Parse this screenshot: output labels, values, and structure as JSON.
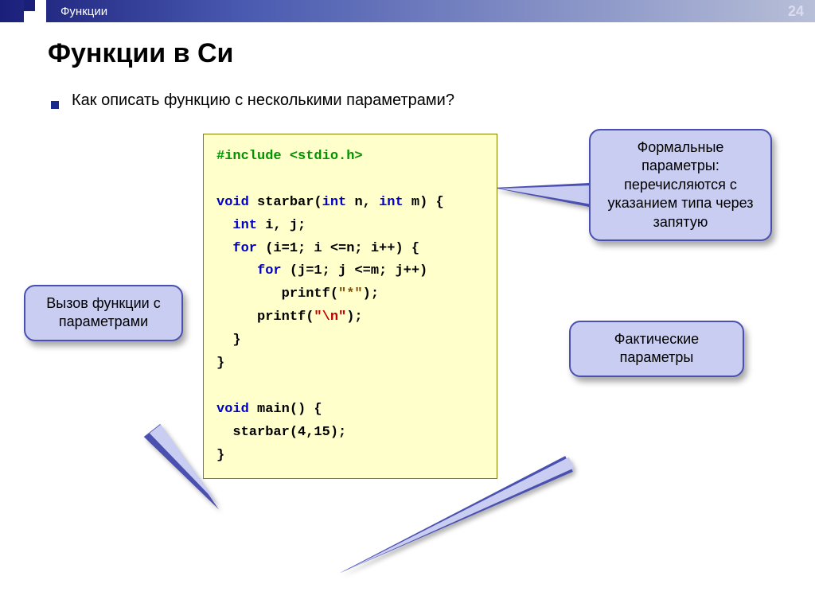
{
  "header": {
    "section": "Функции",
    "page_number": "24"
  },
  "title": "Функции в Си",
  "bullet": "Как описать функцию с несколькими параметрами?",
  "code": {
    "l1": "#include <stdio.h>",
    "l2": "",
    "l3_a": "void",
    "l3_b": " starbar(",
    "l3_c": "int",
    "l3_d": " n, ",
    "l3_e": "int",
    "l3_f": " m) {",
    "l4_a": "  int",
    "l4_b": " i, j;",
    "l5_a": "  for ",
    "l5_b": "(i=1; i <=n; i++) {",
    "l6_a": "     for ",
    "l6_b": "(j=1; j <=m; j++)",
    "l7_a": "        printf(",
    "l7_b": "\"*\"",
    "l7_c": ");",
    "l8_a": "     printf(",
    "l8_b": "\"\\n\"",
    "l8_c": ");",
    "l9": "  }",
    "l10": "}",
    "l11": "",
    "l12_a": "void",
    "l12_b": " main() {",
    "l13": "  starbar(4,15);",
    "l14": "}"
  },
  "callouts": {
    "formal": "Формальные параметры: перечисляются с указанием типа через запятую",
    "actual": "Фактические параметры",
    "call": "Вызов функции с параметрами"
  }
}
